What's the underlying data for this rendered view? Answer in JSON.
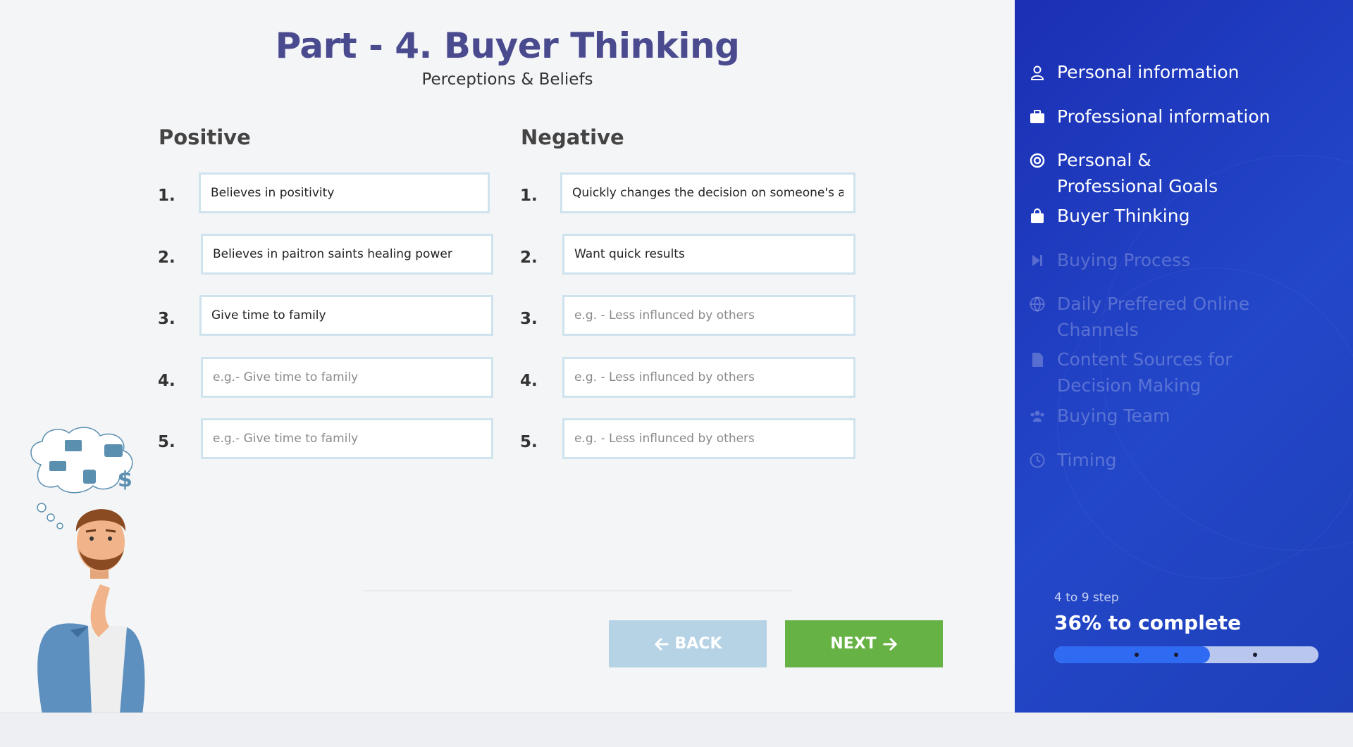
{
  "header": {
    "title": "Part - 4. Buyer Thinking",
    "subtitle": "Perceptions & Beliefs"
  },
  "positive": {
    "heading": "Positive",
    "rows": [
      {
        "number": "1.",
        "value": "Believes in positivity",
        "placeholder": ""
      },
      {
        "number": "2.",
        "value": "Believes in paitron saints healing power",
        "placeholder": ""
      },
      {
        "number": "3.",
        "value": "Give time to family",
        "placeholder": ""
      },
      {
        "number": "4.",
        "value": "",
        "placeholder": "e.g.- Give time to family"
      },
      {
        "number": "5.",
        "value": "",
        "placeholder": "e.g.- Give time to family"
      }
    ]
  },
  "negative": {
    "heading": "Negative",
    "rows": [
      {
        "number": "1.",
        "value": "Quickly changes the decision on someone's advice",
        "placeholder": ""
      },
      {
        "number": "2.",
        "value": "Want quick results",
        "placeholder": ""
      },
      {
        "number": "3.",
        "value": "",
        "placeholder": "e.g. - Less influnced by others"
      },
      {
        "number": "4.",
        "value": "",
        "placeholder": "e.g. - Less influnced by others"
      },
      {
        "number": "5.",
        "value": "",
        "placeholder": "e.g. - Less influnced by others"
      }
    ]
  },
  "buttons": {
    "back_label": "BACK",
    "next_label": "NEXT"
  },
  "sidebar": {
    "steps": [
      {
        "label": "Personal information",
        "icon": "user-icon",
        "active": true
      },
      {
        "label": "Professional information",
        "icon": "briefcase-icon",
        "active": true
      },
      {
        "label": "Personal & Professional Goals",
        "icon": "target-icon",
        "active": true
      },
      {
        "label": "Buyer Thinking",
        "icon": "shopping-bag-icon",
        "active": true
      },
      {
        "label": "Buying Process",
        "icon": "step-forward-icon",
        "active": false
      },
      {
        "label": "Daily Preffered Online Channels",
        "icon": "globe-icon",
        "active": false
      },
      {
        "label": "Content Sources for Decision Making",
        "icon": "document-icon",
        "active": false
      },
      {
        "label": "Buying Team",
        "icon": "team-icon",
        "active": false
      },
      {
        "label": "Timing",
        "icon": "clock-icon",
        "active": false
      }
    ],
    "progress": {
      "caption": "4 to 9 step",
      "text": "36% to complete",
      "fraction": 0.59
    }
  },
  "colors": {
    "title": "#4a4a8f",
    "sidebar": "#1b2fb4",
    "next_button": "#67b244",
    "back_button": "#b6d3e6",
    "progress_fill": "#2e6bf2"
  }
}
